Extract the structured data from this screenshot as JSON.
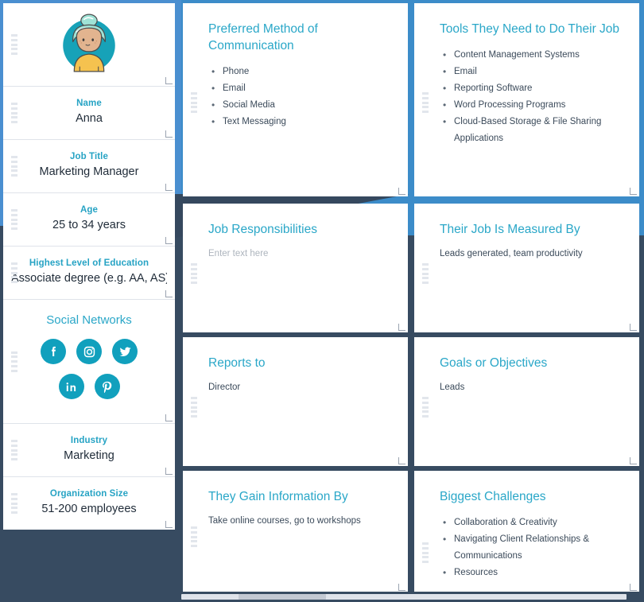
{
  "theme": {
    "accent_teal": "#2aa7c8",
    "label_teal": "#26a3c4",
    "social_teal": "#11a0bd",
    "bg_navy": "#374b61",
    "bg_blue": "#3c8cc9",
    "card_white": "#ffffff",
    "body_text": "#3b4a5a",
    "placeholder_text": "#adb4bd"
  },
  "persona": {
    "avatar": {
      "icon": "avatar-person-icon",
      "hair_color": "#9fe3d6",
      "skin_color": "#e2b48f",
      "shirt_color": "#f5c24f",
      "circle_color": "#17a2b8"
    },
    "fields": [
      {
        "label": "Name",
        "value": "Anna"
      },
      {
        "label": "Job Title",
        "value": "Marketing Manager"
      },
      {
        "label": "Age",
        "value": "25 to 34 years"
      },
      {
        "label": "Highest Level of Education",
        "value": "Associate degree (e.g. AA, AS)"
      }
    ],
    "social": {
      "title": "Social Networks",
      "row1": [
        {
          "name": "facebook-icon",
          "label": "Facebook"
        },
        {
          "name": "instagram-icon",
          "label": "Instagram"
        },
        {
          "name": "twitter-icon",
          "label": "Twitter"
        }
      ],
      "row2": [
        {
          "name": "linkedin-icon",
          "label": "LinkedIn"
        },
        {
          "name": "pinterest-icon",
          "label": "Pinterest"
        }
      ]
    },
    "fields_lower": [
      {
        "label": "Industry",
        "value": "Marketing"
      },
      {
        "label": "Organization Size",
        "value": "51-200 employees"
      }
    ]
  },
  "cards": {
    "preferred_communication": {
      "title": "Preferred Method of Communication",
      "items": [
        "Phone",
        "Email",
        "Social Media",
        "Text Messaging"
      ]
    },
    "tools": {
      "title": "Tools They Need to Do Their Job",
      "items": [
        "Content Management Systems",
        "Email",
        "Reporting Software",
        "Word Processing Programs",
        "Cloud-Based Storage & File Sharing Applications"
      ]
    },
    "job_responsibilities": {
      "title": "Job Responsibilities",
      "placeholder": "Enter text here",
      "value": ""
    },
    "measured_by": {
      "title": "Their Job Is Measured By",
      "value": "Leads generated, team productivity"
    },
    "reports_to": {
      "title": "Reports to",
      "value": "Director"
    },
    "goals": {
      "title": "Goals or Objectives",
      "value": "Leads"
    },
    "gain_information": {
      "title": "They Gain Information By",
      "value": "Take online courses, go to workshops"
    },
    "challenges": {
      "title": "Biggest Challenges",
      "items": [
        "Collaboration & Creativity",
        "Navigating Client Relationships & Communications",
        "Resources"
      ]
    }
  }
}
